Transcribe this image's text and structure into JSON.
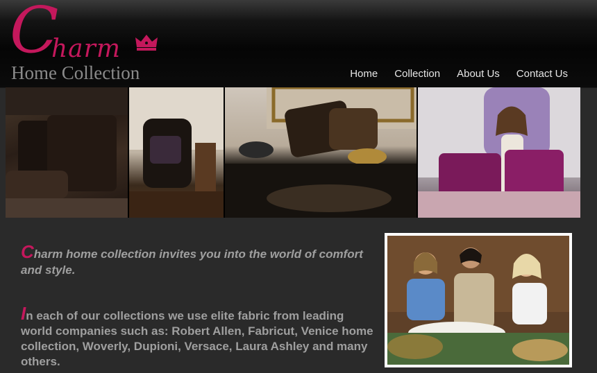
{
  "logo": {
    "charm_initial": "C",
    "charm_rest": "harm",
    "subtitle": "Home Collection",
    "brand_color": "#c4185c"
  },
  "nav": {
    "items": [
      {
        "label": "Home"
      },
      {
        "label": "Collection"
      },
      {
        "label": "About Us"
      },
      {
        "label": "Contact Us"
      }
    ]
  },
  "intro": {
    "initial": "C",
    "rest": "harm home collection invites you into the world of comfort and style."
  },
  "body": {
    "initial": "I",
    "rest": "n each of our collections we use elite fabric from leading world companies such as: Robert Allen, Fabricut, Venice home collection, Woverly, Dupioni, Versace, Laura Ashley and many others."
  },
  "colors": {
    "background": "#2a2a2a",
    "accent": "#c4185c",
    "text": "#9f9f9f",
    "nav_text": "#e6e6e6"
  }
}
